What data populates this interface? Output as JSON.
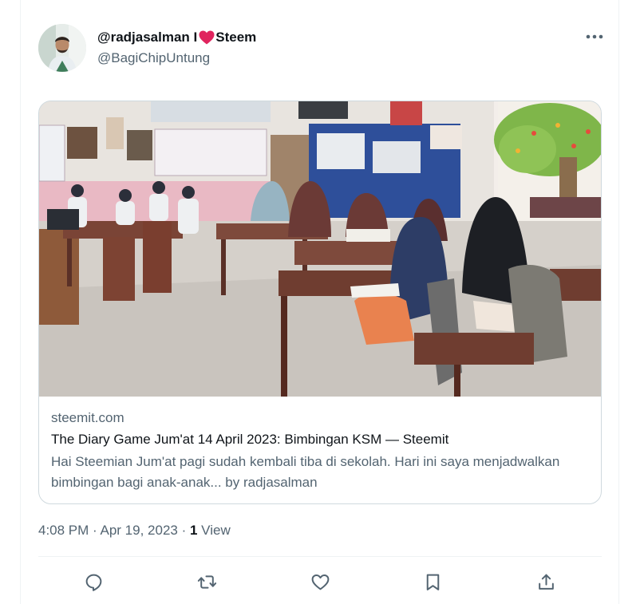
{
  "user": {
    "display_name_before": "@radjasalman I",
    "display_name_after": "Steem",
    "handle": "@BagiChipUntung",
    "heart_color": "#e0245e"
  },
  "card": {
    "domain": "steemit.com",
    "title": "The Diary Game Jum'at 14 April 2023: Bimbingan KSM — Steemit",
    "description": "Hai Steemian Jum'at pagi sudah kembali tiba di sekolah. Hari ini saya menjadwalkan bimbingan bagi anak-anak... by radjasalman"
  },
  "meta": {
    "time": "4:08 PM",
    "separator": "·",
    "date": "Apr 19, 2023",
    "views_count": "1",
    "views_label": "View"
  },
  "icons": {
    "more": "more-horizontal-icon",
    "reply": "reply-icon",
    "retweet": "retweet-icon",
    "like": "heart-icon",
    "bookmark": "bookmark-icon",
    "share": "share-icon"
  },
  "colors": {
    "text_primary": "#0f1419",
    "text_secondary": "#536471",
    "border": "#cfd9de"
  }
}
